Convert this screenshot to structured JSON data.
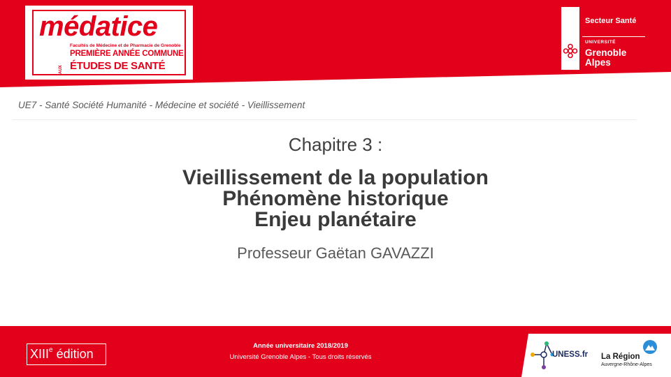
{
  "header": {
    "logo": {
      "wordmark": "médatice",
      "faculties": "Facultés de Médecine et de Pharmacie de Grenoble",
      "line1": "PREMIÈRE ANNÉE COMMUNE",
      "aux": "AUX",
      "line2": "ÉTUDES DE SANTÉ"
    },
    "sector": "Secteur Santé",
    "university_label": "UNIVERSITÉ",
    "university_name_1": "Grenoble",
    "university_name_2": "Alpes"
  },
  "breadcrumb": "UE7 - Santé Société Humanité - Médecine et société - Vieillissement",
  "slide": {
    "chapter": "Chapitre 3 :",
    "title_lines": [
      "Vieillissement de la population",
      "Phénomène historique",
      "Enjeu planétaire"
    ],
    "author": "Professeur Gaëtan GAVAZZI"
  },
  "footer": {
    "edition_numeral": "XIII",
    "edition_sup": "e",
    "edition_word": " édition",
    "year": "Année universitaire 2018/2019",
    "rights": "Université Grenoble Alpes - Tous droits réservés",
    "partner_uness": "UNESS.fr",
    "partner_region": "La Région",
    "partner_region_sub": "Auvergne-Rhône-Alpes"
  },
  "colors": {
    "brand_red": "#e2001a",
    "title_text": "#3a3a3a",
    "breadcrumb_text": "#595959"
  }
}
